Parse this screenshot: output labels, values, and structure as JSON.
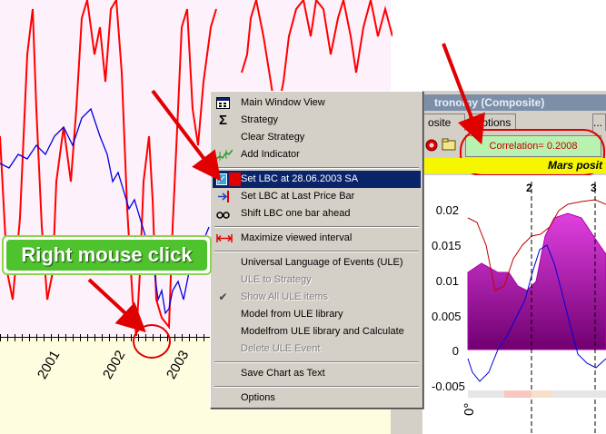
{
  "main_chart": {
    "years": [
      "2001",
      "2002",
      "2003"
    ]
  },
  "composite_window": {
    "title": "tronomy (Composite)",
    "tabs": [
      "osite",
      "Options"
    ],
    "more_button": "...",
    "correlation": "Correlation= 0.2008",
    "yellow_label": "Mars posit",
    "y_ticks": [
      "0.02",
      "0.015",
      "0.01",
      "0.005",
      "0",
      "-0.005"
    ],
    "markers": [
      "2",
      "3"
    ],
    "bottom_label": "0°"
  },
  "context_menu": {
    "items": [
      {
        "label": "Main Window View",
        "icon": "main-window-icon",
        "state": "enabled"
      },
      {
        "label": "Strategy",
        "icon": "sigma-icon",
        "state": "enabled"
      },
      {
        "label": "Clear Strategy",
        "icon": "",
        "state": "enabled"
      },
      {
        "label": "Add Indicator",
        "icon": "add-indicator-icon",
        "state": "enabled"
      },
      {
        "label": "Set LBC at 28.06.2003 SA",
        "icon": "set-lbc-icon",
        "state": "selected"
      },
      {
        "label": "Set LBC at Last Price Bar",
        "icon": "last-price-bar-icon",
        "state": "enabled"
      },
      {
        "label": "Shift LBC one bar ahead",
        "icon": "shift-lbc-icon",
        "state": "enabled"
      },
      {
        "label": "Maximize viewed interval",
        "icon": "maximize-interval-icon",
        "state": "enabled"
      },
      {
        "label": "Universal Language of Events (ULE)",
        "icon": "",
        "state": "enabled"
      },
      {
        "label": "ULE to Strategy",
        "icon": "",
        "state": "disabled"
      },
      {
        "label": "Show All ULE items",
        "icon": "checkmark-icon",
        "state": "disabled"
      },
      {
        "label": "Model from ULE library",
        "icon": "",
        "state": "enabled"
      },
      {
        "label": "Modelfrom ULE library and Calculate",
        "icon": "",
        "state": "enabled"
      },
      {
        "label": "Delete ULE Event",
        "icon": "",
        "state": "disabled"
      },
      {
        "label": "Save Chart as Text",
        "icon": "",
        "state": "enabled"
      },
      {
        "label": "Options",
        "icon": "",
        "state": "enabled"
      }
    ]
  },
  "annotation": {
    "callout": "Right mouse click"
  },
  "colors": {
    "menu_bg": "#d4d0c8",
    "menu_selected": "#0a246a",
    "red_line": "#ff0000",
    "blue_line": "#0000dd",
    "callout_green": "#4fc32e",
    "annotation_red": "#e00000",
    "magenta_fill": "#c000c0"
  }
}
